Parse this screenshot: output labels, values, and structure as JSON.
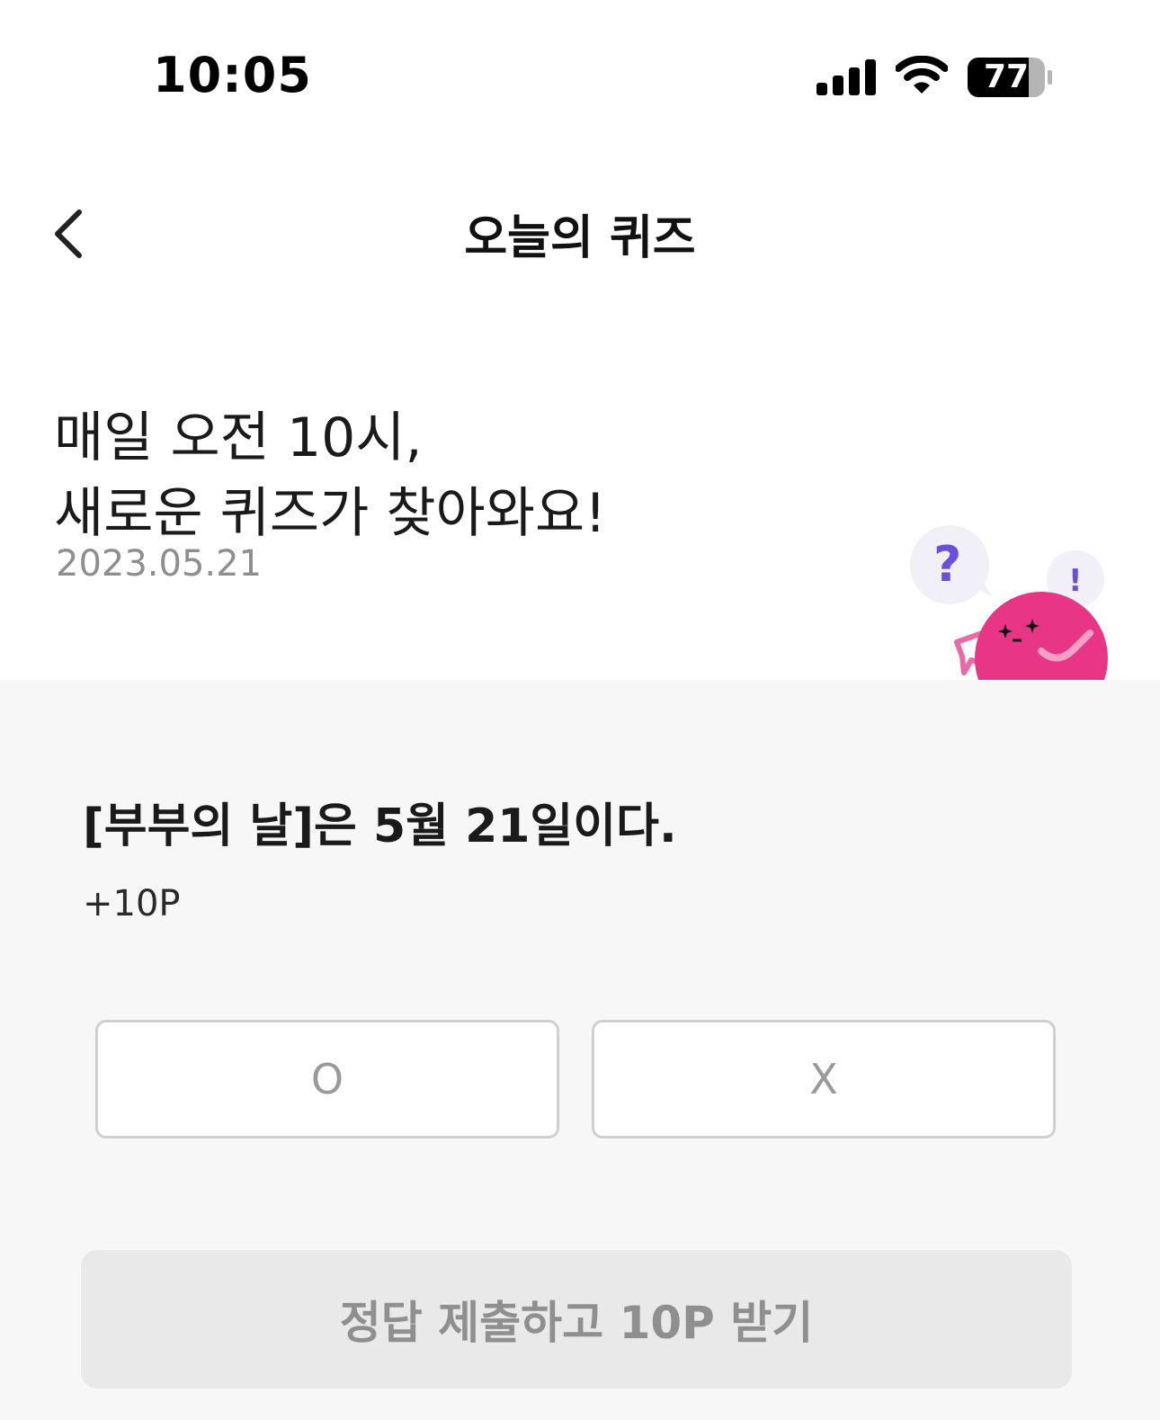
{
  "status_bar": {
    "time": "10:05",
    "battery": "77",
    "icons": [
      "signal-icon",
      "wifi-icon",
      "battery-icon"
    ]
  },
  "header": {
    "title": "오늘의 퀴즈",
    "back_icon": "chevron-left-icon"
  },
  "intro": {
    "line1": "매일 오전 10시,",
    "line2": "새로운 퀴즈가 찾아와요!",
    "date": "2023.05.21"
  },
  "mascot": {
    "bubble_question": "?",
    "bubble_exclaim": "!",
    "colors": {
      "body": "#e83585",
      "bubble": "#f1eff8",
      "mark": "#6b4fd8"
    }
  },
  "quiz": {
    "question": "[부부의 날]은 5월 21일이다.",
    "points": "+10P",
    "options": [
      "O",
      "X"
    ]
  },
  "submit": {
    "label": "정답 제출하고 10P 받기"
  },
  "colors": {
    "panel_bg": "#f7f7f7",
    "button_disabled_bg": "#e9e9e9",
    "button_disabled_text": "#8f8f8f"
  }
}
